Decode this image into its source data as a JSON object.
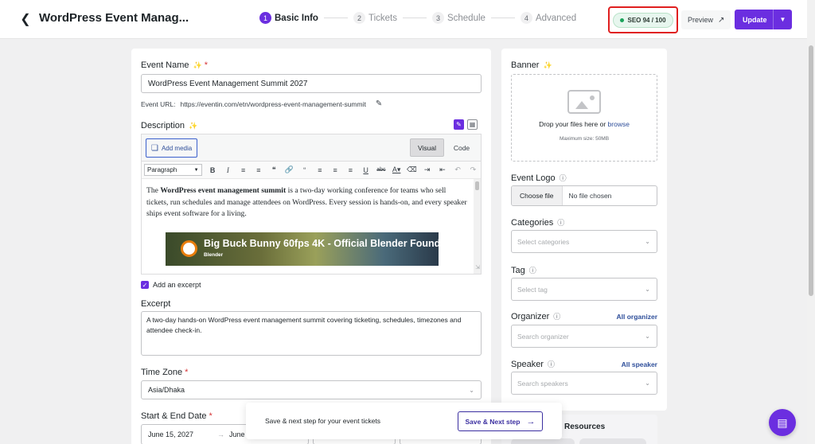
{
  "header": {
    "title": "WordPress Event Manag...",
    "steps": [
      {
        "num": "1",
        "label": "Basic Info"
      },
      {
        "num": "2",
        "label": "Tickets"
      },
      {
        "num": "3",
        "label": "Schedule"
      },
      {
        "num": "4",
        "label": "Advanced"
      }
    ],
    "seo_label": "SEO 94 / 100",
    "preview_label": "Preview",
    "update_label": "Update"
  },
  "main": {
    "event_name_label": "Event Name",
    "required_mark": "*",
    "event_name_value": "WordPress Event Management Summit 2027",
    "url_label": "Event URL:",
    "url_value": "https://eventin.com/etn/wordpress-event-management-summit",
    "description_label": "Description",
    "add_media_label": "Add media",
    "tab_visual": "Visual",
    "tab_code": "Code",
    "format_select": "Paragraph",
    "content_parts": [
      "The ",
      "WordPress event management summit",
      " is a two-day working conference for teams who sell tickets, run schedules and manage attendees on WordPress. Every session is hands-on, and every speaker ships event software for a living."
    ],
    "video_title": "Big Buck Bunny 60fps 4K - Official Blender Found",
    "video_channel": "Blender",
    "excerpt_checkbox_label": "Add an excerpt",
    "excerpt_label": "Excerpt",
    "excerpt_value": "A two-day hands-on WordPress event management summit covering ticketing, schedules, timezones and attendee check-in.",
    "timezone_label": "Time Zone",
    "timezone_value": "Asia/Dhaka",
    "date_label": "Start & End Date",
    "start_date": "June 15, 2027",
    "end_date": "June"
  },
  "sidebar": {
    "banner_label": "Banner",
    "drop_text": "Drop your files here or",
    "browse_text": "browse",
    "max_size": "Maximum size: 50MB",
    "logo_label": "Event Logo",
    "choose_file": "Choose file",
    "no_file": "No file chosen",
    "categories_label": "Categories",
    "categories_placeholder": "Select categories",
    "tag_label": "Tag",
    "tag_placeholder": "Select tag",
    "organizer_label": "Organizer",
    "organizer_link": "All organizer",
    "organizer_placeholder": "Search organizer",
    "speaker_label": "Speaker",
    "speaker_link": "All speaker",
    "speaker_placeholder": "Search speakers",
    "resources_title": "Resources"
  },
  "save_bar": {
    "text": "Save & next step for your event tickets",
    "button": "Save & Next step"
  },
  "colors": {
    "accent": "#6b2ee0",
    "seo_ok": "#1aa35a",
    "highlight": "#e01f1f"
  }
}
